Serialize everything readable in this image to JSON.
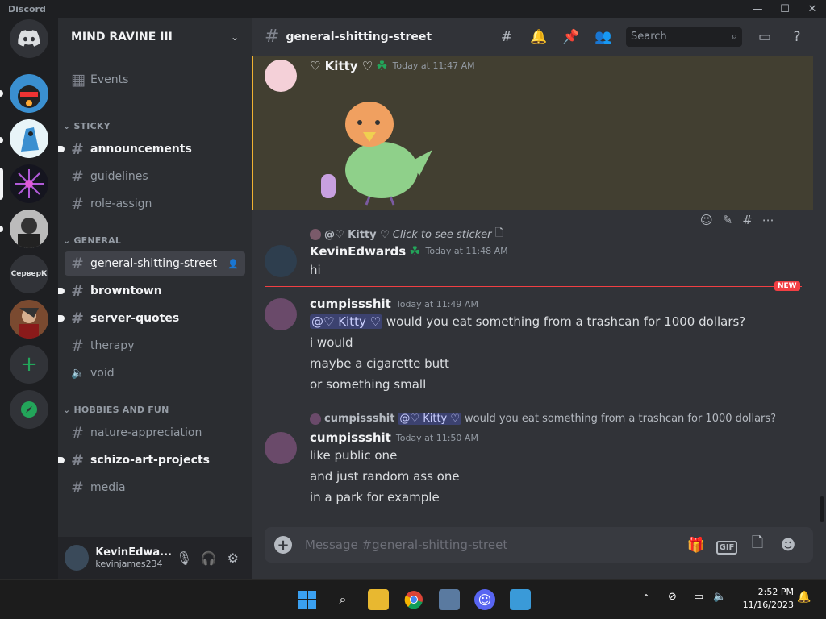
{
  "titlebar": {
    "app": "Discord"
  },
  "window_controls": {
    "minimize": "—",
    "maximize": "☐",
    "close": "✕"
  },
  "servers": [
    {
      "name": "home",
      "label": ""
    },
    {
      "name": "server-1",
      "label": ""
    },
    {
      "name": "server-2",
      "label": ""
    },
    {
      "name": "server-3",
      "label": ""
    },
    {
      "name": "server-4",
      "label": ""
    },
    {
      "name": "server-5",
      "label": "СерверК"
    },
    {
      "name": "server-6",
      "label": ""
    }
  ],
  "sidebar": {
    "guild_name": "MIND RAVINE III",
    "events_label": "Events",
    "categories": {
      "sticky": "STICKY",
      "general": "GENERAL",
      "hobbies": "HOBBIES AND FUN"
    },
    "channels": [
      {
        "name": "announcements"
      },
      {
        "name": "guidelines"
      },
      {
        "name": "role-assign"
      },
      {
        "name": "general-shitting-street"
      },
      {
        "name": "browntown"
      },
      {
        "name": "server-quotes"
      },
      {
        "name": "therapy"
      },
      {
        "name": "void"
      },
      {
        "name": "nature-appreciation"
      },
      {
        "name": "schizo-art-projects"
      },
      {
        "name": "media"
      }
    ]
  },
  "user_panel": {
    "display_name": "KevinEdwa...",
    "tag": "kevinjames234"
  },
  "header": {
    "channel": "general-shitting-street",
    "search_placeholder": "Search"
  },
  "messages": [
    {
      "author": "♡ Kitty ♡",
      "time": "Today at 11:47 AM"
    },
    {
      "reply_author": "@♡ Kitty ♡",
      "reply_text": "Click to see sticker",
      "author": "KevinEdwards",
      "time": "Today at 11:48 AM",
      "lines": [
        "hi"
      ]
    },
    {
      "new_label": "NEW",
      "author": "cumpissshit",
      "time": "Today at 11:49 AM",
      "mention": "@♡ Kitty ♡",
      "mention_text": "would you eat something from a trashcan for 1000 dollars?",
      "lines": [
        "i would",
        "maybe a cigarette butt",
        "or something small"
      ]
    },
    {
      "reply_author": "cumpissshit",
      "reply_mention": "@♡ Kitty ♡",
      "reply_text": "would you eat something from a trashcan for 1000 dollars?",
      "author": "cumpissshit",
      "time": "Today at 11:50 AM",
      "lines": [
        "like public one",
        "and just random ass one",
        "in a park for example"
      ]
    }
  ],
  "composer": {
    "placeholder": "Message #general-shitting-street",
    "gif": "GIF"
  },
  "taskbar": {
    "time": "2:52 PM",
    "date": "11/16/2023"
  }
}
